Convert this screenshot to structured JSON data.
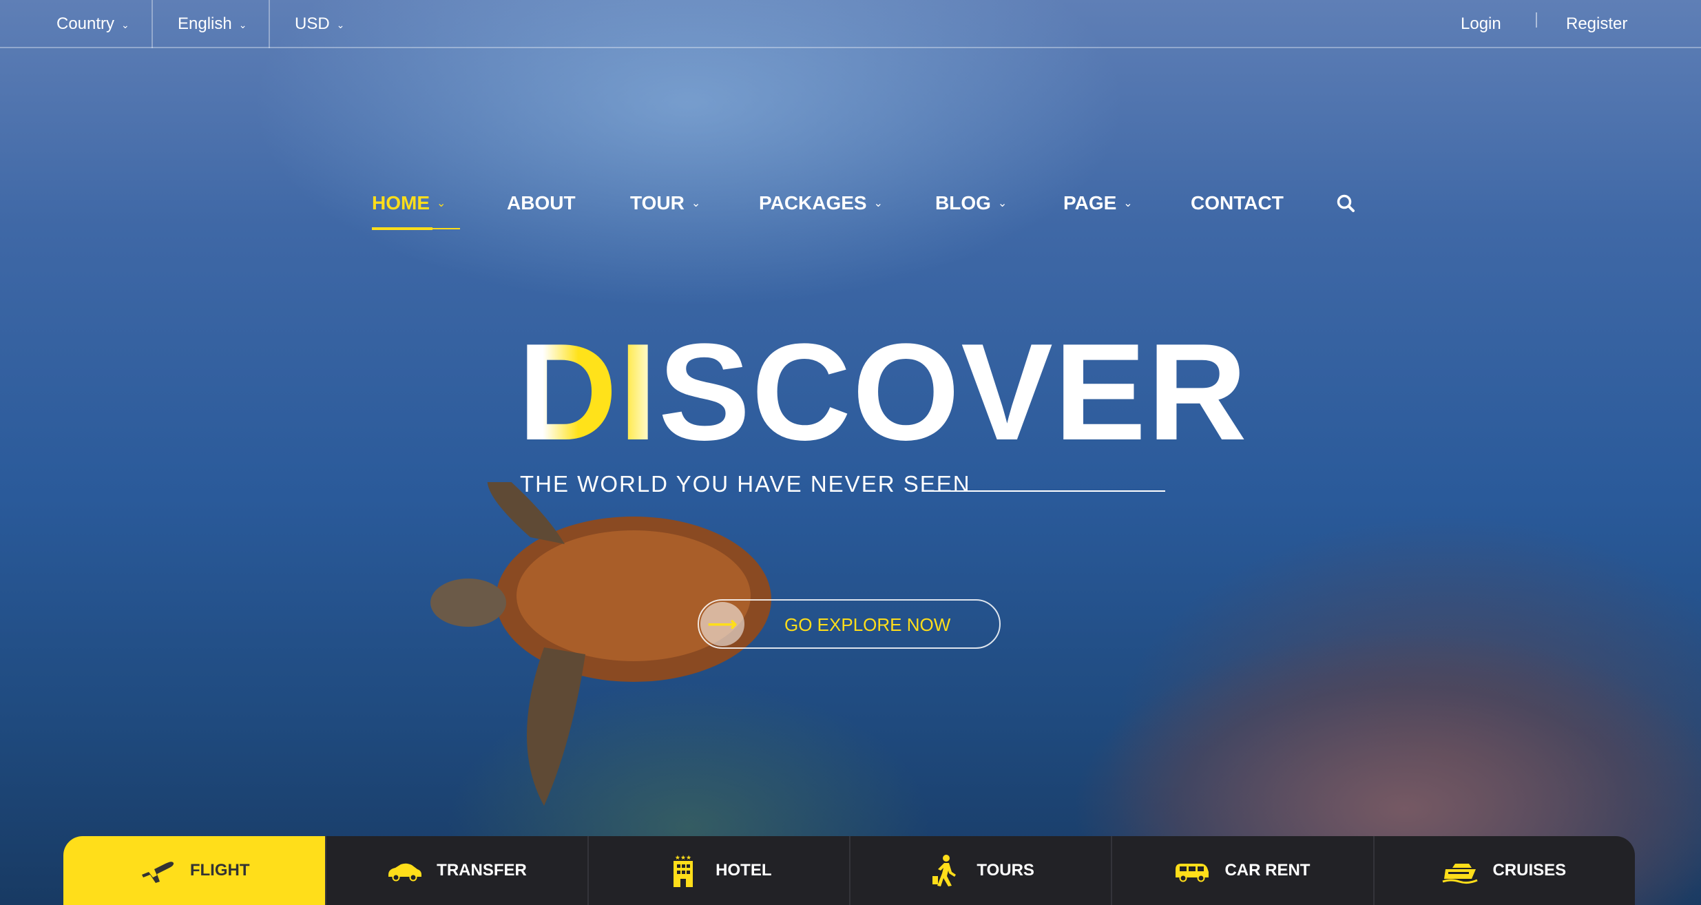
{
  "topbar": {
    "country": "Country",
    "language": "English",
    "currency": "USD",
    "login": "Login",
    "register": "Register"
  },
  "nav": {
    "items": [
      {
        "label": "HOME",
        "dropdown": true,
        "active": true
      },
      {
        "label": "ABOUT",
        "dropdown": false
      },
      {
        "label": "TOUR",
        "dropdown": true
      },
      {
        "label": "PACKAGES",
        "dropdown": true
      },
      {
        "label": "BLOG",
        "dropdown": true
      },
      {
        "label": "PAGE",
        "dropdown": true
      },
      {
        "label": "CONTACT",
        "dropdown": false
      }
    ],
    "search_icon": "search-icon"
  },
  "hero": {
    "title_first": "D",
    "title_second": "I",
    "title_rest": "SCOVER",
    "subtitle": "THE WORLD YOU HAVE NEVER SEEN",
    "cta_label": "GO EXPLORE NOW",
    "cta_icon": "arrow-right-icon"
  },
  "tabs": [
    {
      "label": "FLIGHT",
      "icon": "plane-icon",
      "active": true
    },
    {
      "label": "TRANSFER",
      "icon": "car-icon"
    },
    {
      "label": "HOTEL",
      "icon": "hotel-icon"
    },
    {
      "label": "TOURS",
      "icon": "walking-person-icon"
    },
    {
      "label": "CAR RENT",
      "icon": "van-icon"
    },
    {
      "label": "CRUISES",
      "icon": "ship-icon"
    }
  ],
  "colors": {
    "accent": "#ffde1a",
    "tab_bar": "#222226",
    "text": "#ffffff"
  }
}
